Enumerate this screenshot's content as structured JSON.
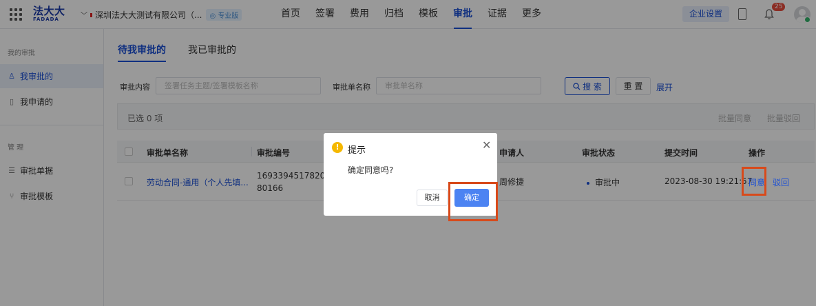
{
  "header": {
    "logo_cn": "法大大",
    "logo_en": "FADADA",
    "company": "深圳法大大测试有限公司（...",
    "edition_badge": "专业版",
    "nav": [
      "首页",
      "签署",
      "费用",
      "归档",
      "模板",
      "审批",
      "证据",
      "更多"
    ],
    "active_nav_index": 5,
    "enterprise_settings": "企业设置",
    "notification_count": "25"
  },
  "sidebar": {
    "group1_title": "我的审批",
    "group1_items": [
      "我审批的",
      "我申请的"
    ],
    "group2_title": "管 理",
    "group2_items": [
      "审批单据",
      "审批模板"
    ]
  },
  "main": {
    "tabs": [
      "待我审批的",
      "我已审批的"
    ],
    "filter": {
      "content_label": "审批内容",
      "content_placeholder": "签署任务主题/签署模板名称",
      "name_label": "审批单名称",
      "name_placeholder": "审批单名称",
      "search_label": "搜 索",
      "reset_label": "重 置",
      "expand_label": "展开"
    },
    "selected_text": "已选 0 项",
    "batch_approve": "批量同意",
    "batch_reject": "批量驳回",
    "table": {
      "headers": [
        "审批单名称",
        "审批编号",
        "申请人",
        "审批状态",
        "提交时间",
        "操作"
      ],
      "rows": [
        {
          "name": "劳动合同-通用（个人先填...",
          "id_line1": "16933945178201",
          "id_line2": "80166",
          "applicant": "周修捷",
          "status": "审批中",
          "submitted": "2023-08-30 19:21:57",
          "action_approve": "同意",
          "action_reject": "驳回"
        }
      ]
    }
  },
  "dialog": {
    "title": "提示",
    "message": "确定同意吗?",
    "cancel": "取消",
    "confirm": "确定"
  },
  "colors": {
    "primary": "#1a4fd6",
    "confirm_button": "#4c83f2",
    "highlight_box": "#d84a1b",
    "warning": "#f5b800"
  }
}
